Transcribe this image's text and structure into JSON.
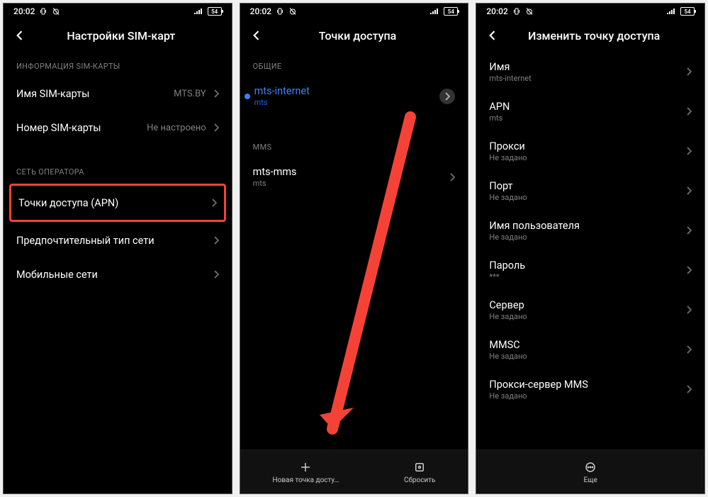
{
  "status": {
    "time": "20:02",
    "battery": "54"
  },
  "screen1": {
    "title": "Настройки SIM-карт",
    "section1": "ИНФОРМАЦИЯ SIM-КАРТЫ",
    "row1": {
      "label": "Имя SIM-карты",
      "value": "MTS.BY"
    },
    "row2": {
      "label": "Номер SIM-карты",
      "value": "Не настроено"
    },
    "section2": "СЕТЬ ОПЕРАТОРА",
    "row3": {
      "label": "Точки доступа (APN)"
    },
    "row4": {
      "label": "Предпочтительный тип сети"
    },
    "row5": {
      "label": "Мобильные сети"
    }
  },
  "screen2": {
    "title": "Точки доступа",
    "section1": "ОБЩИЕ",
    "row1": {
      "label": "mts-internet",
      "sub": "mts"
    },
    "section2": "MMS",
    "row2": {
      "label": "mts-mms",
      "sub": "mts"
    },
    "btn1": "Новая точка досту…",
    "btn2": "Сбросить"
  },
  "screen3": {
    "title": "Изменить точку доступа",
    "rows": [
      {
        "label": "Имя",
        "sub": "mts-internet"
      },
      {
        "label": "APN",
        "sub": "mts"
      },
      {
        "label": "Прокси",
        "sub": "Не задано"
      },
      {
        "label": "Порт",
        "sub": "Не задано"
      },
      {
        "label": "Имя пользователя",
        "sub": "Не задано"
      },
      {
        "label": "Пароль",
        "sub": "***"
      },
      {
        "label": "Сервер",
        "sub": "Не задано"
      },
      {
        "label": "MMSC",
        "sub": "Не задано"
      },
      {
        "label": "Прокси-сервер MMS",
        "sub": "Не задано"
      }
    ],
    "btn": "Еще"
  }
}
